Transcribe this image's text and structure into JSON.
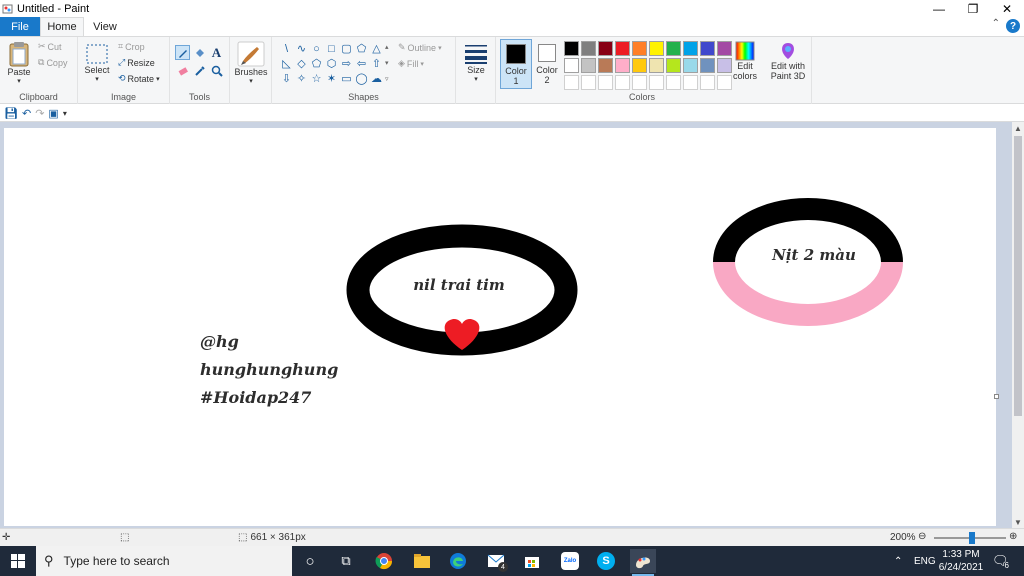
{
  "window": {
    "title": "Untitled - Paint",
    "minimize": "—",
    "restore": "❐",
    "close": "✕"
  },
  "tabs": {
    "file": "File",
    "home": "Home",
    "view": "View"
  },
  "clipboard": {
    "paste": "Paste",
    "cut": "Cut",
    "copy": "Copy",
    "label": "Clipboard"
  },
  "image": {
    "select": "Select",
    "crop": "Crop",
    "resize": "Resize",
    "rotate": "Rotate",
    "label": "Image"
  },
  "tools": {
    "label": "Tools"
  },
  "brushes": {
    "label": "Brushes"
  },
  "shapes": {
    "label": "Shapes",
    "outline": "Outline",
    "fill": "Fill",
    "glyphs": [
      "\\",
      "∿",
      "○",
      "□",
      "▢",
      "⬠",
      "△",
      "◺",
      "◇",
      "⬠",
      "⬡",
      "⇨",
      "⇦",
      "⇧",
      "⇩",
      "✧",
      "☆",
      "✶",
      "▭",
      "◯",
      "☁"
    ]
  },
  "size": {
    "label": "Size"
  },
  "color1": {
    "label": "Color",
    "num": "1",
    "value": "#000000"
  },
  "color2": {
    "label": "Color",
    "num": "2",
    "value": "#ffffff"
  },
  "colors": {
    "label": "Colors",
    "edit_line1": "Edit",
    "edit_line2": "colors",
    "swatches": [
      "#000000",
      "#7f7f7f",
      "#880015",
      "#ed1c24",
      "#ff7f27",
      "#fff200",
      "#22b14c",
      "#00a2e8",
      "#3f48cc",
      "#a349a4",
      "#ffffff",
      "#c3c3c3",
      "#b97a57",
      "#ffaec9",
      "#ffc90e",
      "#efe4b0",
      "#b5e61d",
      "#99d9ea",
      "#7092be",
      "#c8bfe7",
      "#ffffff",
      "#ffffff",
      "#ffffff",
      "#ffffff",
      "#ffffff",
      "#ffffff",
      "#ffffff",
      "#ffffff",
      "#ffffff",
      "#ffffff"
    ]
  },
  "paint3d": {
    "line1": "Edit with",
    "line2": "Paint 3D"
  },
  "canvas": {
    "ring1_text": "nil trai tim",
    "ring2_text": "Nịt 2 màu",
    "caption_line1": "@hg",
    "caption_line2": "hunghunghung",
    "caption_line3": "#Hoidap247",
    "ring_color": "#000000",
    "heart_color": "#ed1c24",
    "pink_color": "#f9a8c4"
  },
  "status": {
    "dimensions": "661 × 361px",
    "zoom": "200%"
  },
  "taskbar": {
    "search_placeholder": "Type here to search",
    "mail_badge": "4",
    "lang": "ENG",
    "time": "1:33 PM",
    "date": "6/24/2021",
    "notif_count": "6"
  }
}
